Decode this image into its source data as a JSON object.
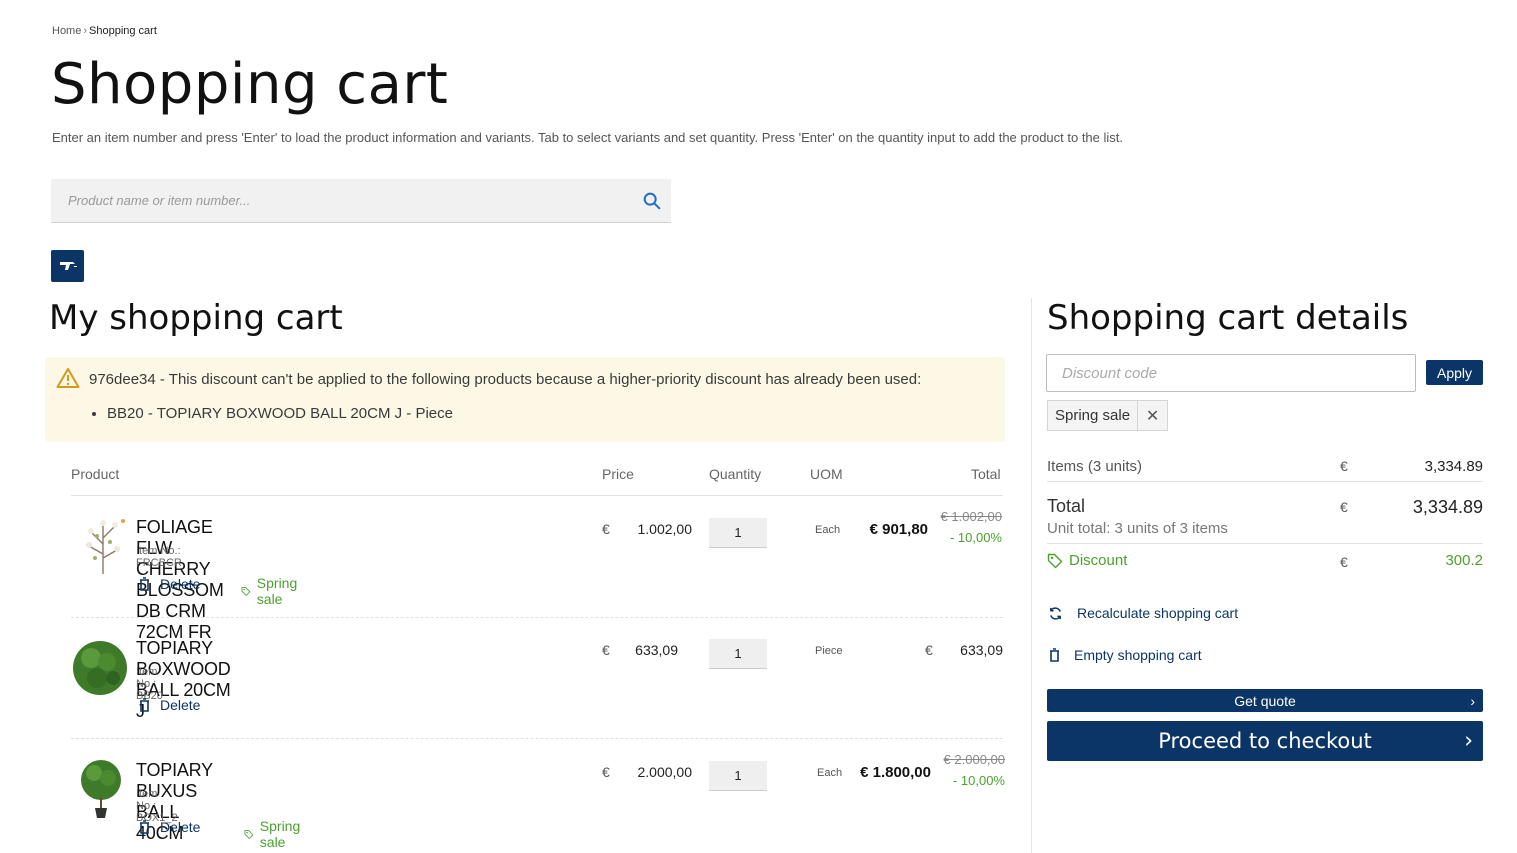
{
  "breadcrumb": {
    "home": "Home",
    "separator": "›",
    "current": "Shopping cart"
  },
  "page_title": "Shopping cart",
  "instructions": "Enter an item number and press 'Enter' to load the product information and variants. Tab to select variants and set quantity. Press 'Enter' on the quantity input to add the product to the list.",
  "search": {
    "placeholder": "Product name or item number...",
    "icon": "search-icon"
  },
  "scan_button": {
    "icon": "barcode-scanner-icon"
  },
  "cart": {
    "title": "My shopping cart",
    "warning": {
      "message": "976dee34 - This discount can't be applied to the following products because a higher-priority discount has already been used:",
      "items": [
        "BB20 - TOPIARY BOXWOOD BALL 20CM J - Piece"
      ]
    },
    "columns": {
      "product": "Product",
      "price": "Price",
      "quantity": "Quantity",
      "uom": "UOM",
      "total": "Total"
    },
    "rows": [
      {
        "name": "FOLIAGE FLW CHERRY BLOSSOM DB CRM 72CM FR",
        "item_no": "Item No.: FRCBCR",
        "currency": "€",
        "price": "1.002,00",
        "quantity": "1",
        "uom": "Each",
        "total": "€ 901,80",
        "original_total": "€ 1.002,00",
        "discount_pct": "- 10,00%",
        "delete_label": "Delete",
        "tag": "Spring sale"
      },
      {
        "name": "TOPIARY BOXWOOD BALL 20CM J",
        "item_no": "Item No.: BB20",
        "currency": "€",
        "price": "633,09",
        "quantity": "1",
        "uom": "Piece",
        "total_currency": "€",
        "total": "633,09",
        "delete_label": "Delete"
      },
      {
        "name": "TOPIARY BUXUS BALL 40CM",
        "item_no": "Item No.: BOX1_2",
        "currency": "€",
        "price": "2.000,00",
        "quantity": "1",
        "uom": "Each",
        "total": "€ 1.800,00",
        "original_total": "€ 2.000,00",
        "discount_pct": "- 10,00%",
        "delete_label": "Delete",
        "tag": "Spring sale"
      }
    ]
  },
  "details": {
    "title": "Shopping cart details",
    "discount_placeholder": "Discount code",
    "apply_label": "Apply",
    "applied_code": "Spring sale",
    "remove_symbol": "✕",
    "items_label": "Items (3 units)",
    "items_currency": "€",
    "items_value": "3,334.89",
    "total_label": "Total",
    "total_currency": "€",
    "total_value": "3,334.89",
    "unit_total": "Unit total: 3 units of 3 items",
    "discount_label": "Discount",
    "discount_currency": "€",
    "discount_value": "300.2",
    "recalculate_label": "Recalculate shopping cart",
    "empty_label": "Empty shopping cart",
    "quote_label": "Get quote",
    "checkout_label": "Proceed to checkout",
    "chevron": "›"
  },
  "colors": {
    "primary": "#0c3567",
    "success": "#4aa12e",
    "warning_bg": "#fdf8e6",
    "warning_icon": "#d39a1a"
  }
}
